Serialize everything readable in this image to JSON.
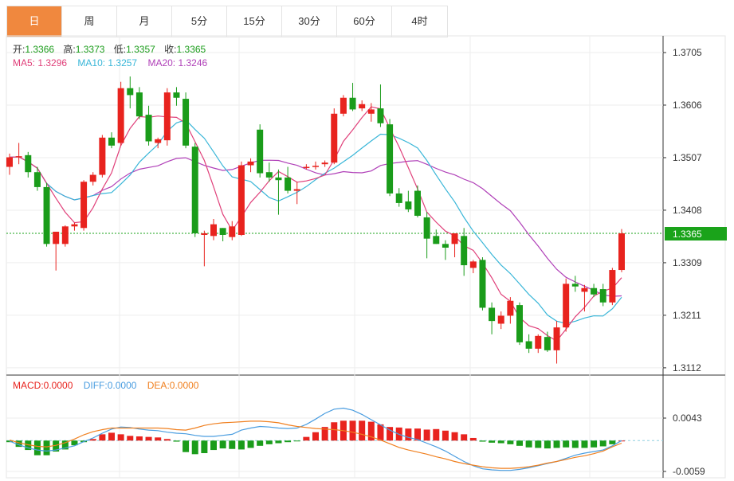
{
  "tabs": [
    {
      "label": "日",
      "active": true
    },
    {
      "label": "周"
    },
    {
      "label": "月"
    },
    {
      "label": "5分"
    },
    {
      "label": "15分"
    },
    {
      "label": "30分"
    },
    {
      "label": "60分"
    },
    {
      "label": "4时"
    }
  ],
  "ohlc_legend": {
    "open_label": "开:",
    "open": "1.3366",
    "high_label": "高:",
    "high": "1.3373",
    "low_label": "低:",
    "low": "1.3357",
    "close_label": "收:",
    "close": "1.3365"
  },
  "ma_legend": {
    "ma5": "MA5: 1.3296",
    "ma10": "MA10: 1.3257",
    "ma20": "MA20: 1.3246"
  },
  "macd_legend": {
    "macd": "MACD:0.0000",
    "diff": "DIFF:0.0000",
    "dea": "DEA:0.0000"
  },
  "colors": {
    "up": "#e8231e",
    "down": "#1a9c1a",
    "ma5": "#e0407a",
    "ma10": "#39b6d8",
    "ma20": "#b040b8",
    "diff": "#4a9de0",
    "dea": "#f08020",
    "last_price": "#1aa31a",
    "label_green": "#1a9c1a"
  },
  "chart_data": [
    {
      "type": "candlestick",
      "y_ticks": [
        "1.3705",
        "1.3606",
        "1.3507",
        "1.3408",
        "1.3309",
        "1.3211",
        "1.3112"
      ],
      "ylim": [
        1.3105,
        1.3735
      ],
      "last_price": "1.3365",
      "candles": [
        [
          1.349,
          1.3515,
          1.3475,
          1.3508
        ],
        [
          1.3508,
          1.3535,
          1.3495,
          1.351
        ],
        [
          1.3512,
          1.3518,
          1.347,
          1.348
        ],
        [
          1.348,
          1.349,
          1.3445,
          1.3452
        ],
        [
          1.3452,
          1.346,
          1.334,
          1.3345
        ],
        [
          1.3345,
          1.3365,
          1.3295,
          1.3368
        ],
        [
          1.3345,
          1.338,
          1.334,
          1.3378
        ],
        [
          1.3378,
          1.3385,
          1.337,
          1.3382
        ],
        [
          1.3375,
          1.3465,
          1.337,
          1.3462
        ],
        [
          1.3462,
          1.348,
          1.3455,
          1.3475
        ],
        [
          1.3475,
          1.355,
          1.347,
          1.3545
        ],
        [
          1.3545,
          1.3555,
          1.3525,
          1.353
        ],
        [
          1.3535,
          1.365,
          1.353,
          1.3638
        ],
        [
          1.3638,
          1.366,
          1.36,
          1.3625
        ],
        [
          1.363,
          1.364,
          1.358,
          1.3585
        ],
        [
          1.3588,
          1.3605,
          1.353,
          1.3538
        ],
        [
          1.3535,
          1.3545,
          1.3525,
          1.3542
        ],
        [
          1.354,
          1.3638,
          1.353,
          1.363
        ],
        [
          1.363,
          1.364,
          1.3605,
          1.362
        ],
        [
          1.3618,
          1.363,
          1.3525,
          1.353
        ],
        [
          1.3528,
          1.3535,
          1.3358,
          1.3365
        ],
        [
          1.3362,
          1.337,
          1.3303,
          1.3365
        ],
        [
          1.336,
          1.3392,
          1.3352,
          1.3382
        ],
        [
          1.3375,
          1.3375,
          1.335,
          1.3362
        ],
        [
          1.3358,
          1.3388,
          1.3352,
          1.3378
        ],
        [
          1.3362,
          1.35,
          1.336,
          1.3493
        ],
        [
          1.3493,
          1.3506,
          1.348,
          1.35
        ],
        [
          1.356,
          1.357,
          1.347,
          1.3478
        ],
        [
          1.348,
          1.3498,
          1.3462,
          1.347
        ],
        [
          1.347,
          1.3485,
          1.34,
          1.3465
        ],
        [
          1.347,
          1.349,
          1.344,
          1.3445
        ],
        [
          1.3445,
          1.3462,
          1.342,
          1.3448
        ],
        [
          1.349,
          1.3495,
          1.3485,
          1.349
        ],
        [
          1.349,
          1.35,
          1.3485,
          1.3492
        ],
        [
          1.3495,
          1.3502,
          1.349,
          1.3498
        ],
        [
          1.3498,
          1.36,
          1.3495,
          1.359
        ],
        [
          1.359,
          1.3625,
          1.3585,
          1.362
        ],
        [
          1.362,
          1.3648,
          1.3595,
          1.3598
        ],
        [
          1.36,
          1.3615,
          1.3595,
          1.3608
        ],
        [
          1.359,
          1.361,
          1.3575,
          1.3598
        ],
        [
          1.36,
          1.3645,
          1.3565,
          1.3572
        ],
        [
          1.357,
          1.358,
          1.3435,
          1.344
        ],
        [
          1.344,
          1.345,
          1.3415,
          1.3422
        ],
        [
          1.3425,
          1.3445,
          1.3405,
          1.341
        ],
        [
          1.3445,
          1.3455,
          1.3395,
          1.3398
        ],
        [
          1.3395,
          1.3405,
          1.3318,
          1.3355
        ],
        [
          1.336,
          1.3372,
          1.3345,
          1.3345
        ],
        [
          1.3345,
          1.3352,
          1.3315,
          1.3338
        ],
        [
          1.3345,
          1.3365,
          1.332,
          1.3365
        ],
        [
          1.336,
          1.3375,
          1.3285,
          1.3305
        ],
        [
          1.33,
          1.3315,
          1.329,
          1.3312
        ],
        [
          1.3315,
          1.332,
          1.322,
          1.3225
        ],
        [
          1.3225,
          1.3235,
          1.3175,
          1.32
        ],
        [
          1.3195,
          1.3218,
          1.3185,
          1.321
        ],
        [
          1.321,
          1.3245,
          1.3195,
          1.3238
        ],
        [
          1.323,
          1.3235,
          1.3155,
          1.316
        ],
        [
          1.3162,
          1.3175,
          1.314,
          1.3148
        ],
        [
          1.3148,
          1.3175,
          1.314,
          1.3172
        ],
        [
          1.317,
          1.318,
          1.3142,
          1.3145
        ],
        [
          1.3145,
          1.32,
          1.312,
          1.3188
        ],
        [
          1.3188,
          1.328,
          1.318,
          1.327
        ],
        [
          1.327,
          1.3285,
          1.3255,
          1.3265
        ],
        [
          1.3255,
          1.3268,
          1.3218,
          1.3262
        ],
        [
          1.3262,
          1.327,
          1.3245,
          1.325
        ],
        [
          1.326,
          1.327,
          1.3228,
          1.3235
        ],
        [
          1.3235,
          1.33,
          1.323,
          1.3296
        ],
        [
          1.3296,
          1.3373,
          1.3292,
          1.3365
        ]
      ]
    },
    {
      "type": "bar",
      "y_ticks": [
        "0.0043",
        "-0.0059"
      ],
      "ylim": [
        -0.0073,
        0.0063
      ],
      "macd_values": [
        -0.0003,
        -0.0012,
        -0.0018,
        -0.0028,
        -0.0028,
        -0.0021,
        -0.0017,
        -0.0009,
        -0.0003,
        0.0003,
        0.0012,
        0.0015,
        0.0012,
        0.0009,
        0.0008,
        0.0007,
        0.0006,
        0.0003,
        -0.0002,
        -0.0022,
        -0.0026,
        -0.0024,
        -0.0018,
        -0.0015,
        -0.0016,
        -0.0017,
        -0.0014,
        -0.001,
        -0.0007,
        -0.0005,
        -0.0003,
        -0.0001,
        0.0007,
        0.0016,
        0.0026,
        0.0035,
        0.0038,
        0.0038,
        0.0038,
        0.0036,
        0.0031,
        0.0026,
        0.0025,
        0.0023,
        0.0023,
        0.0021,
        0.0022,
        0.0019,
        0.0016,
        0.0012,
        0.0005,
        -0.0002,
        -0.0004,
        -0.0005,
        -0.0007,
        -0.001,
        -0.0013,
        -0.0014,
        -0.0015,
        -0.0014,
        -0.0013,
        -0.0014,
        -0.0014,
        -0.0013,
        -0.0011,
        -0.0007,
        0.0
      ],
      "diff_values": [
        -0.0001,
        -0.0008,
        -0.0014,
        -0.0018,
        -0.002,
        -0.0018,
        -0.0014,
        -0.001,
        -0.0002,
        0.0005,
        0.0014,
        0.0022,
        0.0026,
        0.0025,
        0.0022,
        0.002,
        0.0019,
        0.0016,
        0.0014,
        0.0013,
        0.001,
        0.0008,
        0.0008,
        0.001,
        0.0012,
        0.002,
        0.0024,
        0.0027,
        0.0026,
        0.0024,
        0.0023,
        0.0024,
        0.0031,
        0.0041,
        0.0052,
        0.006,
        0.0062,
        0.0058,
        0.005,
        0.004,
        0.003,
        0.002,
        0.0012,
        0.0006,
        0.0002,
        -0.0005,
        -0.0012,
        -0.002,
        -0.003,
        -0.004,
        -0.0048,
        -0.0054,
        -0.0056,
        -0.0057,
        -0.0057,
        -0.0055,
        -0.0052,
        -0.0048,
        -0.0044,
        -0.004,
        -0.0034,
        -0.0028,
        -0.0024,
        -0.0021,
        -0.0018,
        -0.001,
        0.0
      ],
      "dea_values": [
        0.0001,
        -0.0004,
        -0.0008,
        -0.0011,
        -0.0012,
        -0.0009,
        -0.0004,
        0.0003,
        0.0011,
        0.0017,
        0.0021,
        0.0024,
        0.0024,
        0.0024,
        0.0024,
        0.0024,
        0.0024,
        0.0023,
        0.0021,
        0.002,
        0.0024,
        0.0029,
        0.0032,
        0.0034,
        0.0035,
        0.0036,
        0.0037,
        0.0037,
        0.0036,
        0.0034,
        0.003,
        0.0027,
        0.0025,
        0.0023,
        0.0022,
        0.0021,
        0.0019,
        0.0016,
        0.0012,
        0.0007,
        0.0001,
        -0.0006,
        -0.0013,
        -0.0018,
        -0.0022,
        -0.0026,
        -0.0031,
        -0.0035,
        -0.004,
        -0.0044,
        -0.0047,
        -0.005,
        -0.0052,
        -0.0053,
        -0.0053,
        -0.0052,
        -0.005,
        -0.0047,
        -0.0043,
        -0.004,
        -0.0036,
        -0.0032,
        -0.0029,
        -0.0025,
        -0.002,
        -0.0012,
        -0.0005
      ]
    }
  ]
}
